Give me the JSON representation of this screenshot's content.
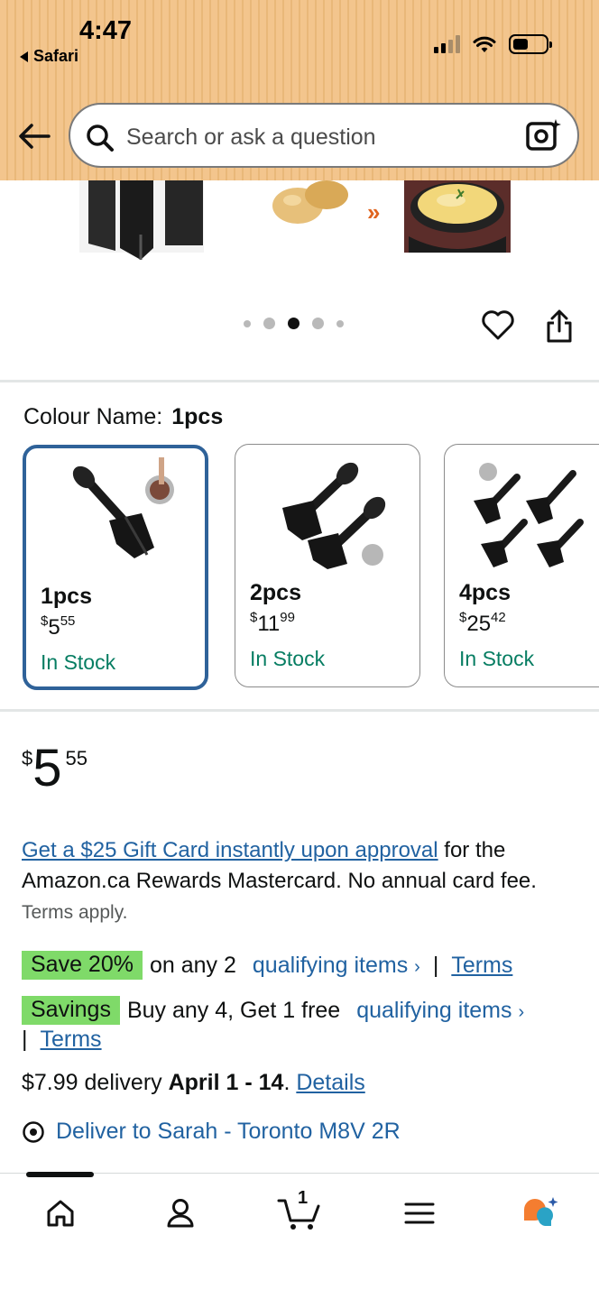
{
  "status_bar": {
    "time": "4:47",
    "back_app": "Safari"
  },
  "search": {
    "placeholder": "Search or ask a question"
  },
  "gallery": {
    "dot_count": 5,
    "active_dot": 3
  },
  "colour": {
    "label": "Colour Name:",
    "selected": "1pcs",
    "options": [
      {
        "name": "1pcs",
        "price_symbol": "$",
        "price_whole": "5",
        "price_fraction": "55",
        "stock": "In Stock"
      },
      {
        "name": "2pcs",
        "price_symbol": "$",
        "price_whole": "11",
        "price_fraction": "99",
        "stock": "In Stock"
      },
      {
        "name": "4pcs",
        "price_symbol": "$",
        "price_whole": "25",
        "price_fraction": "42",
        "stock": "In Stock"
      }
    ]
  },
  "price": {
    "symbol": "$",
    "whole": "5",
    "fraction": "55"
  },
  "gift_card": {
    "link": "Get a $25 Gift Card instantly upon approval",
    "text": " for the Amazon.ca Rewards Mastercard. No annual card fee.",
    "terms": "Terms apply."
  },
  "promos": [
    {
      "badge": "Save 20%",
      "text": "on any 2",
      "link": "qualifying items",
      "chevron": "›",
      "separator": "|",
      "terms": "Terms"
    },
    {
      "badge": "Savings",
      "text": "Buy any 4, Get 1 free",
      "link": "qualifying items",
      "chevron": "›",
      "separator": "|",
      "terms": "Terms"
    }
  ],
  "delivery": {
    "prefix": "$7.99 delivery ",
    "dates": "April 1 - 14",
    "period": ".",
    "details": "Details"
  },
  "deliver_to": {
    "text": "Deliver to Sarah - Toronto M8V 2R"
  },
  "bottom_nav": {
    "cart_count": "1"
  },
  "colors": {
    "accent_green": "#7fda69",
    "link_blue": "#2162a1",
    "stock_green": "#067d62",
    "selected_border": "#2f6299"
  }
}
